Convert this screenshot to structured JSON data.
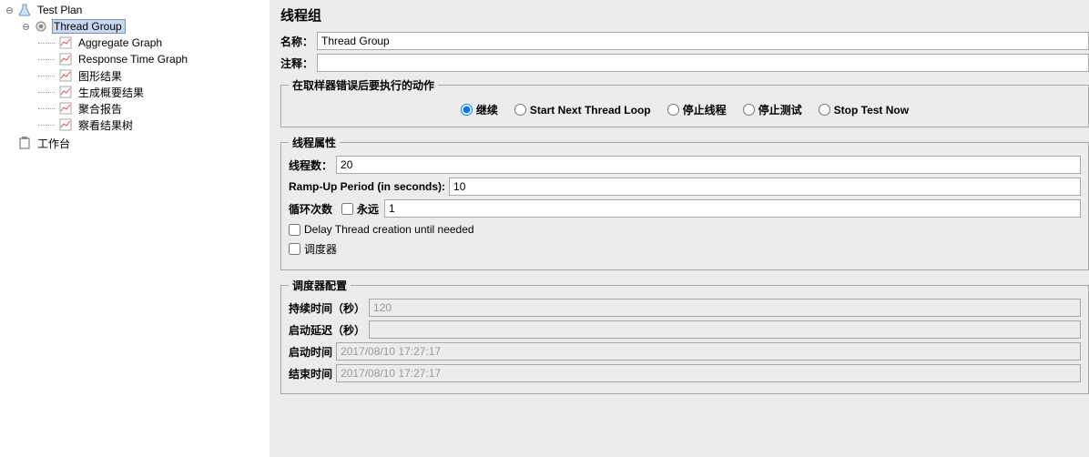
{
  "tree": {
    "root": "Test Plan",
    "thread_group": "Thread Group",
    "items": [
      "Aggregate Graph",
      "Response Time Graph",
      "图形结果",
      "生成概要结果",
      "聚合报告",
      "察看结果树"
    ],
    "workbench": "工作台"
  },
  "title": "线程组",
  "name_label": "名称：",
  "name_value": "Thread Group",
  "comment_label": "注释：",
  "comment_value": "",
  "on_error": {
    "legend": "在取样器错误后要执行的动作",
    "opts": [
      "继续",
      "Start Next Thread Loop",
      "停止线程",
      "停止测试",
      "Stop Test Now"
    ],
    "selected": 0
  },
  "thread_props": {
    "legend": "线程属性",
    "threads_label": "线程数：",
    "threads_value": "20",
    "ramp_label": "Ramp-Up Period (in seconds):",
    "ramp_value": "10",
    "loop_label": "循环次数",
    "forever_label": "永远",
    "forever_checked": false,
    "loop_value": "1",
    "delay_label": "Delay Thread creation until needed",
    "delay_checked": false,
    "scheduler_label": "调度器",
    "scheduler_checked": false
  },
  "scheduler": {
    "legend": "调度器配置",
    "duration_label": "持续时间（秒）",
    "duration_value": "120",
    "delay_label": "启动延迟（秒）",
    "delay_value": "",
    "start_label": "启动时间",
    "start_value": "2017/08/10 17:27:17",
    "end_label": "结束时间",
    "end_value": "2017/08/10 17:27:17"
  }
}
